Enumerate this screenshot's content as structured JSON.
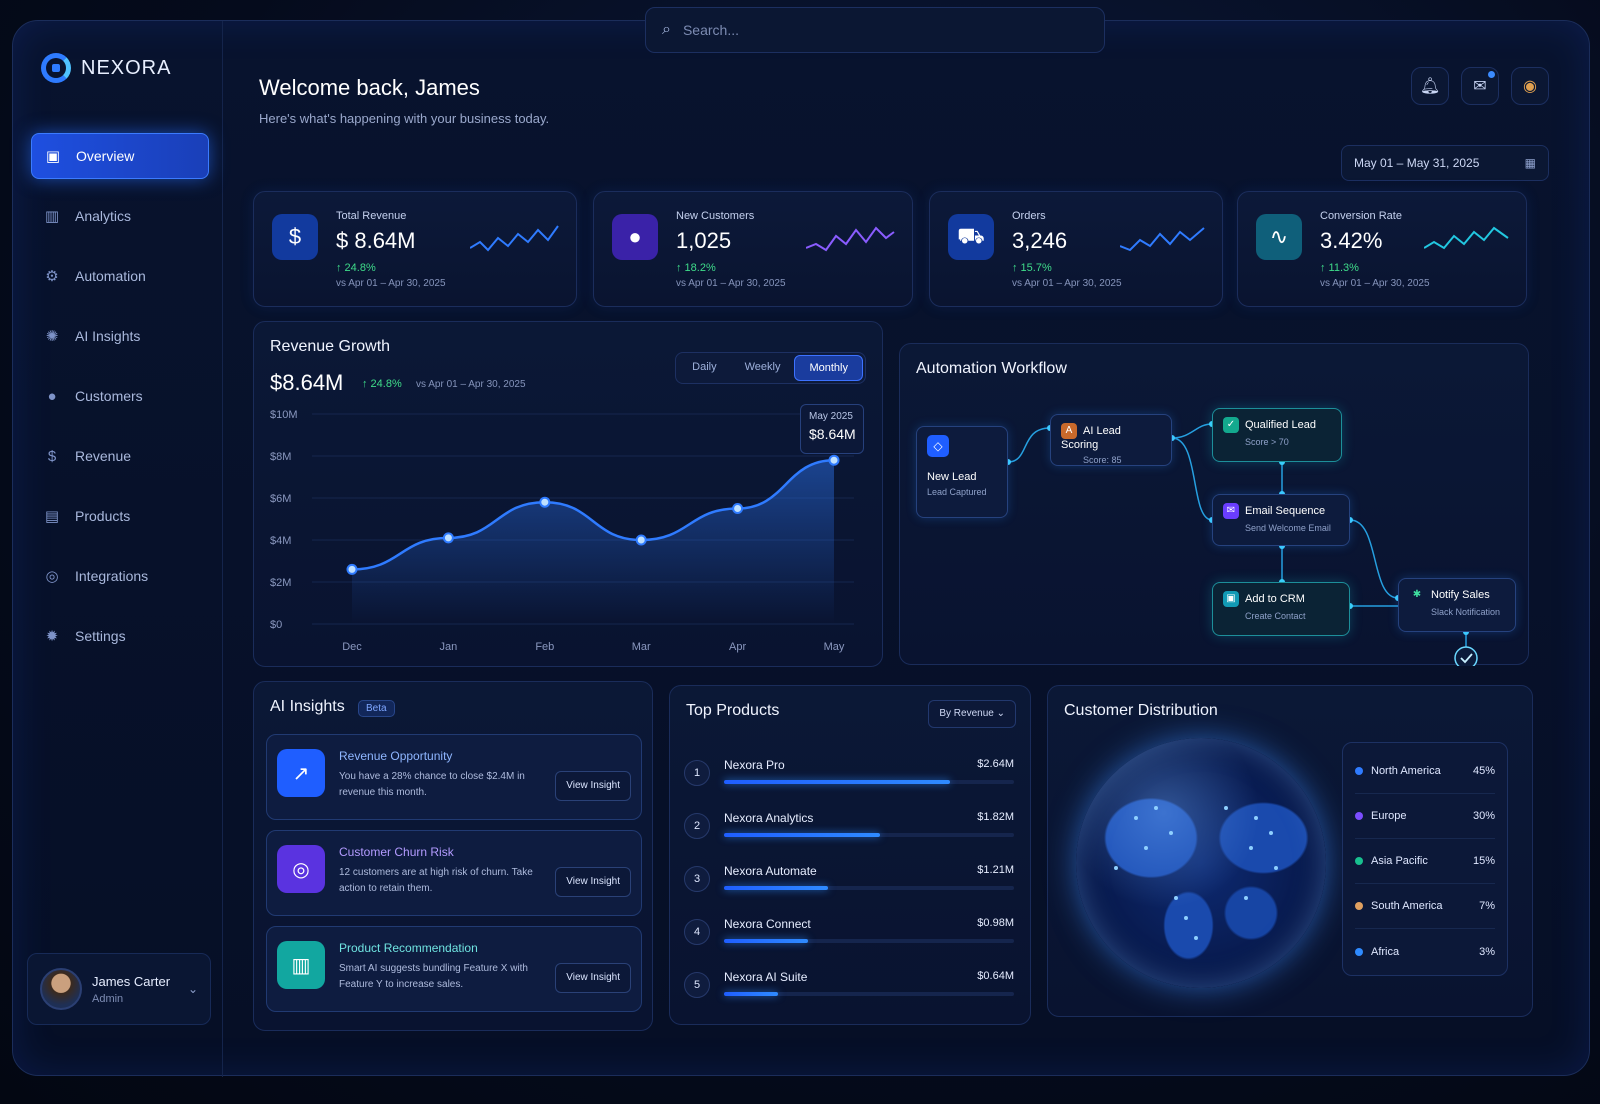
{
  "brand": {
    "name": "NEXORA"
  },
  "search": {
    "placeholder": "Search..."
  },
  "header": {
    "title": "Welcome back, James",
    "subtitle": "Here's what's happening with your business today.",
    "date_range": "May 01 – May 31, 2025"
  },
  "sidebar": {
    "items": [
      {
        "label": "Overview",
        "icon": "overview-icon",
        "active": true
      },
      {
        "label": "Analytics",
        "icon": "bar-chart-icon"
      },
      {
        "label": "Automation",
        "icon": "automation-icon"
      },
      {
        "label": "AI Insights",
        "icon": "brain-icon"
      },
      {
        "label": "Customers",
        "icon": "user-icon"
      },
      {
        "label": "Revenue",
        "icon": "dollar-icon"
      },
      {
        "label": "Products",
        "icon": "box-icon"
      },
      {
        "label": "Integrations",
        "icon": "integration-icon"
      },
      {
        "label": "Settings",
        "icon": "gear-icon"
      }
    ],
    "user": {
      "name": "James Carter",
      "role": "Admin"
    }
  },
  "kpis": [
    {
      "label": "Total Revenue",
      "value": "$ 8.64M",
      "change": "↑ 24.8%",
      "sub": "vs Apr 01 – Apr 30, 2025",
      "icon": "dollar-icon",
      "color": "#1f5eff"
    },
    {
      "label": "New Customers",
      "value": "1,025",
      "change": "↑ 18.2%",
      "sub": "vs Apr 01 – Apr 30, 2025",
      "icon": "user-icon",
      "color": "#6a3dff"
    },
    {
      "label": "Orders",
      "value": "3,246",
      "change": "↑ 15.7%",
      "sub": "vs Apr 01 – Apr 30, 2025",
      "icon": "cart-icon",
      "color": "#1f6bff"
    },
    {
      "label": "Conversion Rate",
      "value": "3.42%",
      "change": "↑ 11.3%",
      "sub": "vs Apr 01 – Apr 30, 2025",
      "icon": "pulse-icon",
      "color": "#17b7d8"
    }
  ],
  "revenue_growth": {
    "title": "Revenue Growth",
    "value": "$8.64M",
    "change": "↑ 24.8%",
    "sub": "vs Apr 01 – Apr 30, 2025",
    "tabs": [
      "Daily",
      "Weekly",
      "Monthly"
    ],
    "active_tab": "Monthly",
    "tooltip": {
      "label": "May 2025",
      "value": "$8.64M"
    }
  },
  "chart_data": {
    "type": "line",
    "categories": [
      "Dec",
      "Jan",
      "Feb",
      "Mar",
      "Apr",
      "May"
    ],
    "values": [
      2.6,
      4.1,
      5.8,
      4.0,
      5.5,
      7.8
    ],
    "yticks": [
      "$10M",
      "$8M",
      "$6M",
      "$4M",
      "$2M",
      "$0"
    ],
    "ylim": [
      0,
      10
    ],
    "color": "#2f7bff"
  },
  "workflow": {
    "title": "Automation Workflow",
    "nodes": {
      "new_lead": {
        "title": "New Lead",
        "sub": "Lead Captured"
      },
      "scoring": {
        "title": "AI Lead Scoring",
        "sub": "Score: 85"
      },
      "qualified": {
        "title": "Qualified Lead",
        "sub": "Score > 70"
      },
      "email": {
        "title": "Email Sequence",
        "sub": "Send Welcome Email"
      },
      "crm": {
        "title": "Add to CRM",
        "sub": "Create Contact"
      },
      "notify": {
        "title": "Notify Sales",
        "sub": "Slack Notification"
      }
    }
  },
  "ai_insights": {
    "title": "AI Insights",
    "badge": "Beta",
    "items": [
      {
        "title": "Revenue Opportunity",
        "desc": "You have a 28% chance to close $2.4M in revenue this month.",
        "button": "View Insight",
        "color": "#1f5eff",
        "title_color": "#8fb6ff"
      },
      {
        "title": "Customer Churn Risk",
        "desc": "12 customers are at high risk of churn. Take action to retain them.",
        "button": "View Insight",
        "color": "#6a3dff",
        "title_color": "#b39bff"
      },
      {
        "title": "Product Recommendation",
        "desc": "Smart AI suggests bundling Feature X with Feature Y to increase sales.",
        "button": "View Insight",
        "color": "#12a7a0",
        "title_color": "#6fe3e0"
      }
    ]
  },
  "top_products": {
    "title": "Top Products",
    "sort": "By Revenue",
    "items": [
      {
        "rank": "1",
        "name": "Nexora Pro",
        "value": "$2.64M",
        "share": 1.0
      },
      {
        "rank": "2",
        "name": "Nexora Analytics",
        "value": "$1.82M",
        "share": 0.69
      },
      {
        "rank": "3",
        "name": "Nexora Automate",
        "value": "$1.21M",
        "share": 0.46
      },
      {
        "rank": "4",
        "name": "Nexora Connect",
        "value": "$0.98M",
        "share": 0.37
      },
      {
        "rank": "5",
        "name": "Nexora AI Suite",
        "value": "$0.64M",
        "share": 0.24
      }
    ]
  },
  "customer_distribution": {
    "title": "Customer Distribution",
    "regions": [
      {
        "name": "North America",
        "pct": "45%",
        "color": "#2f7bff"
      },
      {
        "name": "Europe",
        "pct": "30%",
        "color": "#7b4dff"
      },
      {
        "name": "Asia Pacific",
        "pct": "15%",
        "color": "#18c08f"
      },
      {
        "name": "South America",
        "pct": "7%",
        "color": "#e0a060"
      },
      {
        "name": "Africa",
        "pct": "3%",
        "color": "#2f8bff"
      }
    ]
  }
}
